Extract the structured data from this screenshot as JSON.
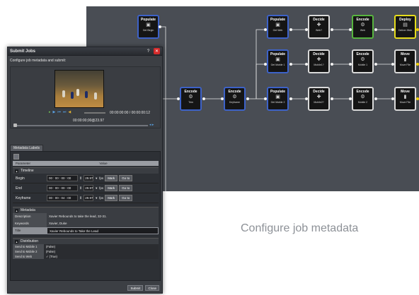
{
  "canvas": {
    "nodes": [
      {
        "title": "Populate",
        "sub": "Get Begin",
        "icon": "film-icon"
      },
      {
        "title": "Populate",
        "sub": "Get Web",
        "icon": "film-icon"
      },
      {
        "title": "Decide",
        "sub": "Web?",
        "icon": "decision-icon"
      },
      {
        "title": "Encode",
        "sub": "Web",
        "icon": "gears-icon"
      },
      {
        "title": "Deploy",
        "sub": "Deliver Web",
        "icon": "deploy-icon"
      },
      {
        "title": "Populate",
        "sub": "Get Mobile 1",
        "icon": "film-icon"
      },
      {
        "title": "Decide",
        "sub": "Mobile1?",
        "icon": "decision-icon"
      },
      {
        "title": "Encode",
        "sub": "Mobile 1",
        "icon": "gears-icon"
      },
      {
        "title": "Move",
        "sub": "Move File",
        "icon": "file-icon"
      },
      {
        "title": "Encode",
        "sub": "Trim",
        "icon": "gears-icon"
      },
      {
        "title": "Encode",
        "sub": "Keyframe",
        "icon": "gears-icon"
      },
      {
        "title": "Populate",
        "sub": "Get Mobile 2",
        "icon": "film-icon"
      },
      {
        "title": "Decide",
        "sub": "Mobile2?",
        "icon": "decision-icon"
      },
      {
        "title": "Encode",
        "sub": "Mobile 2",
        "icon": "gears-icon"
      },
      {
        "title": "Move",
        "sub": "Move File",
        "icon": "file-icon"
      }
    ]
  },
  "caption": "Configure job metadata",
  "dialog": {
    "title": "Submit Jobs",
    "help": "?",
    "close": "✕",
    "instruction": "Configure job metadata and submit:",
    "player": {
      "timecode": "00:00:00:00 / 00:00:00:12",
      "timecode2": "00:00:00;00@23.97"
    },
    "tab_label": "Metadata Labels",
    "grid_headers": {
      "param": "Parameter",
      "value": "Value"
    },
    "timeline": {
      "label": "Timeline",
      "rows": [
        {
          "key": "Begin",
          "tc": "00 : 00 : 00 : 00",
          "fps": "29.97",
          "fps_label": "fps",
          "mark": "Mark",
          "goto": "Go to"
        },
        {
          "key": "End",
          "tc": "00 : 00 : 00 : 00",
          "fps": "29.97",
          "fps_label": "fps",
          "mark": "Mark",
          "goto": "Go to"
        },
        {
          "key": "Keyframe",
          "tc": "00 : 00 : 04 : 00",
          "fps": "29.97",
          "fps_label": "fps",
          "mark": "Mark",
          "goto": "Go to"
        }
      ]
    },
    "metadata": {
      "label": "Metadata",
      "rows": [
        {
          "key": "Description",
          "value": "Xavier Rebounds to take the lead, 32-31."
        },
        {
          "key": "Keywords",
          "value": "Xavier, Duke"
        },
        {
          "key": "Title",
          "value": "Xavier Rebounds to Take the Lead"
        }
      ]
    },
    "distribution": {
      "label": "Distribution",
      "rows": [
        {
          "key": "Send to Mobile 1",
          "value": "(False)"
        },
        {
          "key": "Send to Mobile 2",
          "value": "(False)"
        },
        {
          "key": "Send to Web",
          "value": "✓ (True)"
        }
      ]
    },
    "submit": "Submit",
    "close_btn": "Close"
  }
}
